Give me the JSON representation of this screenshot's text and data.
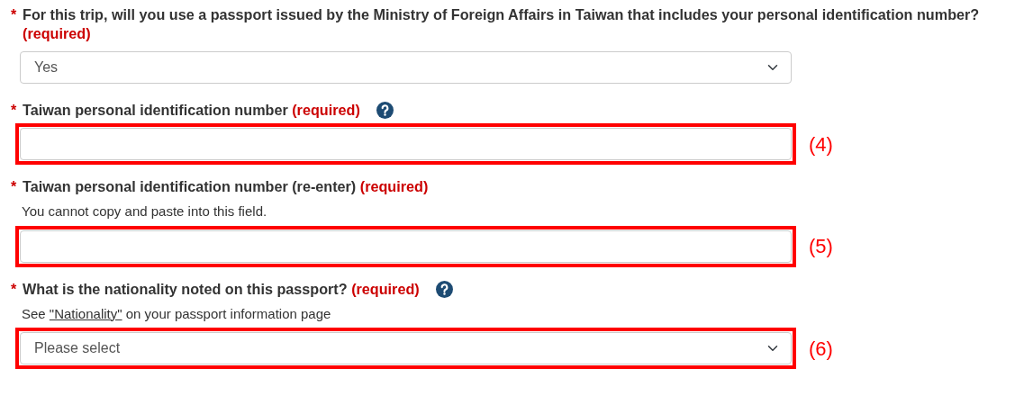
{
  "fields": [
    {
      "question": "For this trip, will you use a passport issued by the Ministry of Foreign Affairs in Taiwan that includes your personal identification number?",
      "required_tag": "(required)",
      "help": false,
      "control": {
        "kind": "select",
        "value": "Yes"
      },
      "highlighted": false
    },
    {
      "question": "Taiwan personal identification number",
      "required_tag": "(required)",
      "help": true,
      "control": {
        "kind": "text"
      },
      "highlighted": true,
      "callout": "(4)"
    },
    {
      "question": "Taiwan personal identification number (re-enter)",
      "required_tag": "(required)",
      "help": false,
      "hint": [
        {
          "kind": "text",
          "text": "You cannot copy and paste into this field."
        }
      ],
      "control": {
        "kind": "text"
      },
      "highlighted": true,
      "callout": "(5)"
    },
    {
      "question": "What is the nationality noted on this passport?",
      "required_tag": "(required)",
      "help": true,
      "hint": [
        {
          "kind": "text",
          "text": "See "
        },
        {
          "kind": "link",
          "text": "\"Nationality\""
        },
        {
          "kind": "text",
          "text": " on your passport information page"
        }
      ],
      "control": {
        "kind": "select",
        "value": "Please select"
      },
      "highlighted": true,
      "callout": "(6)"
    }
  ],
  "asterisk": "*"
}
